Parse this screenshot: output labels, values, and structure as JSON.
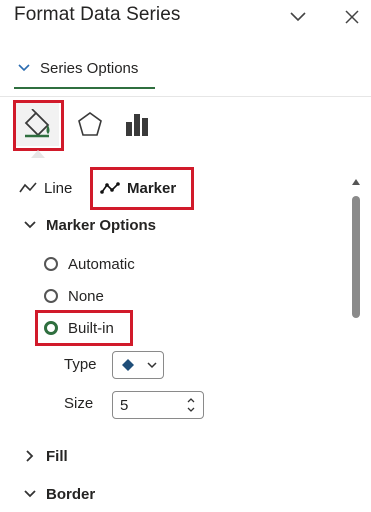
{
  "pane": {
    "title": "Format Data Series",
    "collapse_icon": "chevron-down-icon",
    "close_icon": "close-icon"
  },
  "series_options": {
    "label": "Series Options",
    "expanded": true
  },
  "category_tabs": [
    {
      "name": "fill-line",
      "icon": "paint-bucket-icon",
      "selected": true,
      "highlighted": true
    },
    {
      "name": "effects",
      "icon": "pentagon-icon",
      "selected": false
    },
    {
      "name": "series-options",
      "icon": "bar-chart-icon",
      "selected": false
    }
  ],
  "sub_tabs": {
    "line_label": "Line",
    "marker_label": "Marker",
    "active": "Marker"
  },
  "marker_options": {
    "label": "Marker Options",
    "expanded": true,
    "radios": [
      {
        "label": "Automatic",
        "checked": false
      },
      {
        "label": "None",
        "checked": false
      },
      {
        "label": "Built-in",
        "checked": true
      }
    ],
    "type_label": "Type",
    "type_icon": "marker-diamond-icon",
    "size_label": "Size",
    "size_value": "5"
  },
  "fill_section": {
    "label": "Fill",
    "expanded": false
  },
  "border_section": {
    "label": "Border",
    "expanded": true
  },
  "colors": {
    "accent": "#2f6f3f",
    "highlight": "#d11a2a",
    "marker": "#1f4e79"
  }
}
